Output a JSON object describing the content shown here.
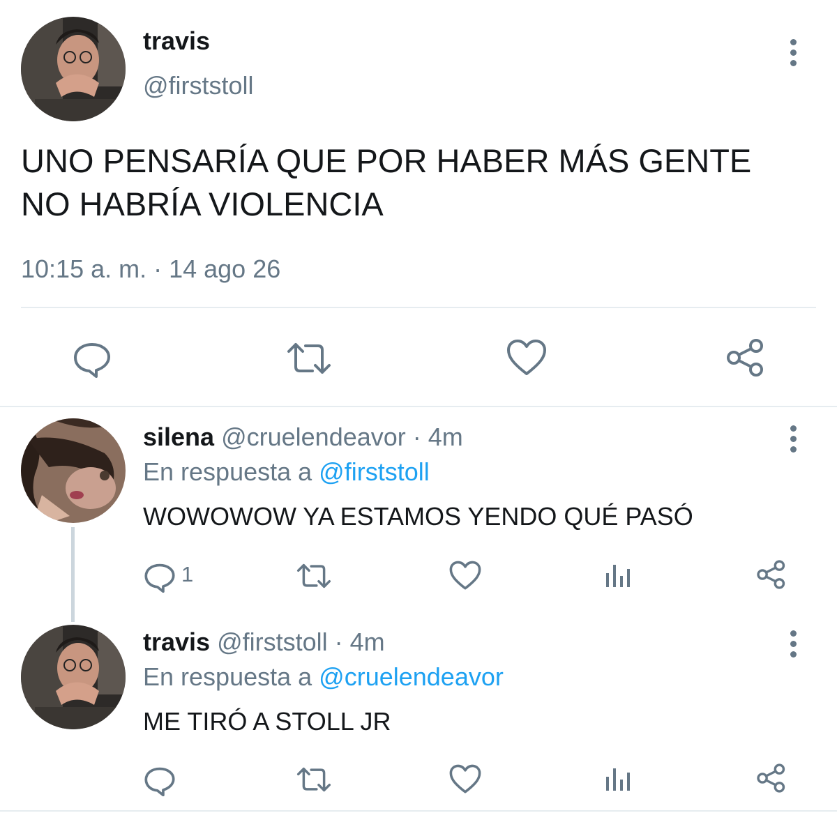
{
  "main_tweet": {
    "display_name": "travis",
    "handle": "@firststoll",
    "text_line1": "UNO PENSARÍA QUE POR HABER MÁS GENTE",
    "text_line2": "NO HABRÍA VIOLENCIA",
    "timestamp": "10:15 a. m. · 14 ago 26",
    "actions": [
      "reply-icon",
      "retweet-icon",
      "like-icon",
      "share-icon"
    ]
  },
  "replies": [
    {
      "display_name": "silena",
      "handle": "@cruelendeavor",
      "time": "· 4m",
      "reply_prefix": "En respuesta a",
      "reply_to": "@firststoll",
      "text": "WOWOWOW YA ESTAMOS YENDO QUÉ PASÓ",
      "reply_count": "1"
    },
    {
      "display_name": "travis",
      "handle": "@firststoll",
      "time": "· 4m",
      "reply_prefix": "En respuesta a",
      "reply_to": "@cruelendeavor",
      "text": "ME TIRÓ A STOLL JR",
      "reply_count": ""
    }
  ],
  "colors": {
    "icon_gray": "#657786",
    "link_blue": "#1da1f2",
    "divider": "#e6ecf0",
    "thread_line": "#ccd6dd"
  }
}
